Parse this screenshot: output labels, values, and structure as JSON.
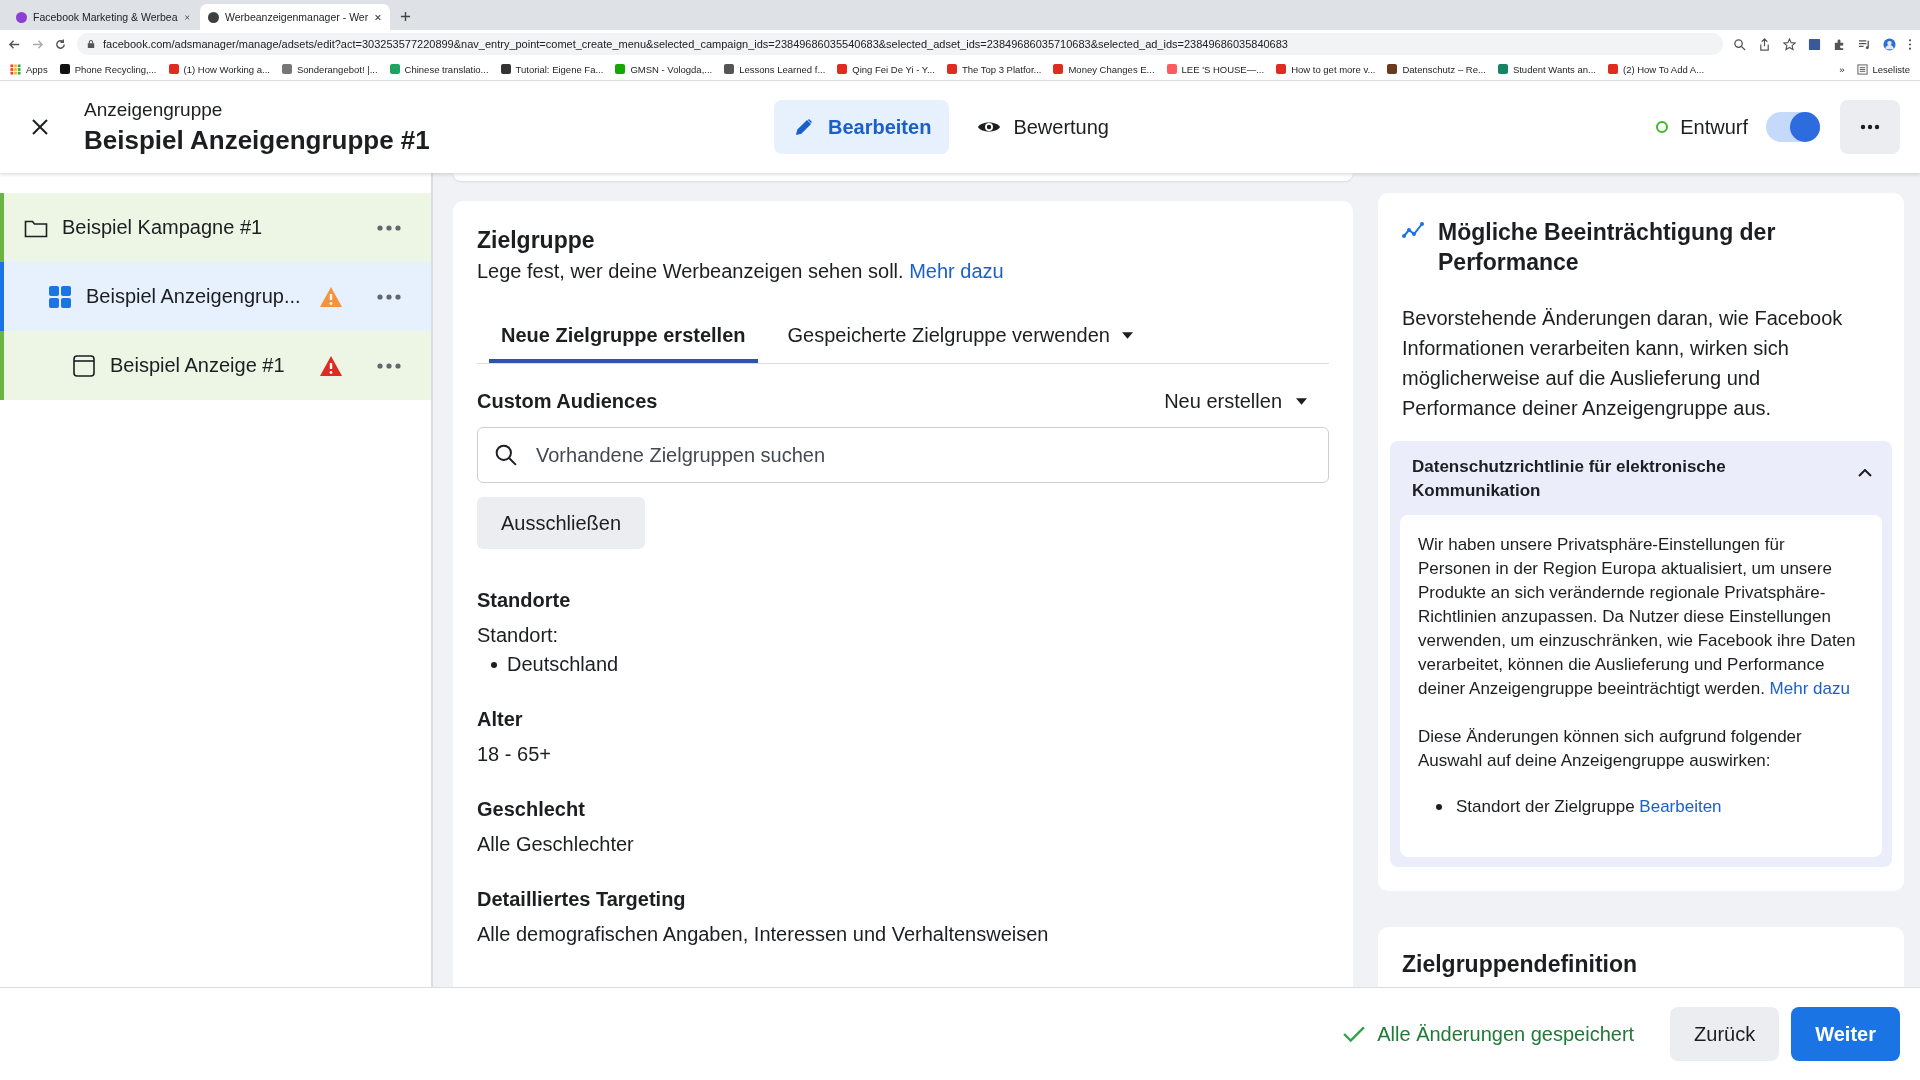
{
  "browser": {
    "tabs": [
      {
        "title": "Facebook Marketing & Werbea",
        "selected": false,
        "color": "#8e3fd1"
      },
      {
        "title": "Werbeanzeigenmanager - Wer",
        "selected": true,
        "color": "#3c4043"
      }
    ],
    "url": "facebook.com/adsmanager/manage/adsets/edit?act=303253577220899&nav_entry_point=comet_create_menu&selected_campaign_ids=23849686035540683&selected_adset_ids=23849686035710683&selected_ad_ids=23849686035840683",
    "apps": "Apps",
    "bookmarks": [
      {
        "label": "Phone Recycling,...",
        "color": "#111111"
      },
      {
        "label": "(1) How Working a...",
        "color": "#e02b20"
      },
      {
        "label": "Sonderangebot! |...",
        "color": "#777777"
      },
      {
        "label": "Chinese translatio...",
        "color": "#1da462"
      },
      {
        "label": "Tutorial: Eigene Fa...",
        "color": "#333333"
      },
      {
        "label": "GMSN - Vologda,...",
        "color": "#14a800"
      },
      {
        "label": "Lessons Learned f...",
        "color": "#555555"
      },
      {
        "label": "Qing Fei De Yi - Y...",
        "color": "#e02b20"
      },
      {
        "label": "The Top 3 Platfor...",
        "color": "#e02b20"
      },
      {
        "label": "Money Changes E...",
        "color": "#e02b20"
      },
      {
        "label": "LEE 'S HOUSE—...",
        "color": "#ff5a5f"
      },
      {
        "label": "How to get more v...",
        "color": "#e02b20"
      },
      {
        "label": "Datenschutz – Re...",
        "color": "#6b3a1e"
      },
      {
        "label": "Student Wants an...",
        "color": "#158466"
      },
      {
        "label": "(2) How To Add A...",
        "color": "#e02b20"
      }
    ],
    "more": "»",
    "reading_list": "Leseliste"
  },
  "header": {
    "subtitle": "Anzeigengruppe",
    "title": "Beispiel Anzeigengruppe #1",
    "modes": [
      {
        "label": "Bearbeiten",
        "selected": true,
        "kind": "pencil"
      },
      {
        "label": "Bewertung",
        "selected": false,
        "kind": "eye"
      }
    ],
    "status": "Entwurf",
    "toggle_on": true
  },
  "sidebar": {
    "items": [
      {
        "label": "Beispiel Kampagne #1",
        "kind": "folder",
        "selected": false,
        "children": [
          {
            "label": "Beispiel Anzeigengrup...",
            "kind": "grid",
            "selected": true,
            "color": "#f7923b",
            "children": [
              {
                "label": "Beispiel Anzeige #1",
                "kind": "ad",
                "selected": false,
                "color": "#e02b20"
              }
            ]
          }
        ]
      }
    ]
  },
  "audience": {
    "title": "Zielgruppe",
    "subtitle": "Lege fest, wer deine Werbeanzeigen sehen soll.",
    "link": "Mehr dazu",
    "tabs": [
      {
        "label": "Neue Zielgruppe erstellen",
        "selected": true,
        "dropdown": false
      },
      {
        "label": "Gespeicherte Zielgruppe verwenden",
        "selected": false,
        "dropdown": true
      }
    ],
    "custom_label": "Custom Audiences",
    "create": "Neu erstellen",
    "search": {
      "placeholder": "Vorhandene Zielgruppen suchen"
    },
    "exclude": "Ausschließen",
    "sections": [
      {
        "heading": "Standorte",
        "label": "Standort:",
        "items": [
          "Deutschland"
        ]
      },
      {
        "heading": "Alter",
        "value": "18 - 65+"
      },
      {
        "heading": "Geschlecht",
        "value": "Alle Geschlechter"
      },
      {
        "heading": "Detailliertes Targeting",
        "value": "Alle demografischen Angaben, Interessen und Verhaltensweisen"
      }
    ]
  },
  "performance": {
    "title": "Mögliche Beeinträchtigung der Performance",
    "body": "Bevorstehende Änderungen daran, wie Facebook Informationen verarbeiten kann, wirken sich möglicherweise auf die Auslieferung und Performance deiner Anzeigengruppe aus.",
    "accordion": {
      "title": "Datenschutzrichtlinie für elektronische Kommunikation",
      "expanded": true,
      "text": "Wir haben unsere Privatsphäre-Einstellungen für Personen in der Region Europa aktualisiert, um unsere Produkte an sich verändernde regionale Privatsphäre-Richtlinien anzupassen. Da Nutzer diese Einstellungen verwenden, um einzuschränken, wie Facebook ihre Daten verarbeitet, können die Auslieferung und Performance deiner Anzeigengruppe beeinträchtigt werden.",
      "link": "Mehr dazu",
      "text2": "Diese Änderungen können sich aufgrund folgender Auswahl auf deine Anzeigengruppe auswirken:",
      "bullets": [
        {
          "text": "Standort der Zielgruppe",
          "link": "Bearbeiten"
        }
      ]
    },
    "next_heading": "Zielgruppendefinition"
  },
  "footer": {
    "saved": "Alle Änderungen gespeichert",
    "back": "Zurück",
    "next": "Weiter"
  }
}
